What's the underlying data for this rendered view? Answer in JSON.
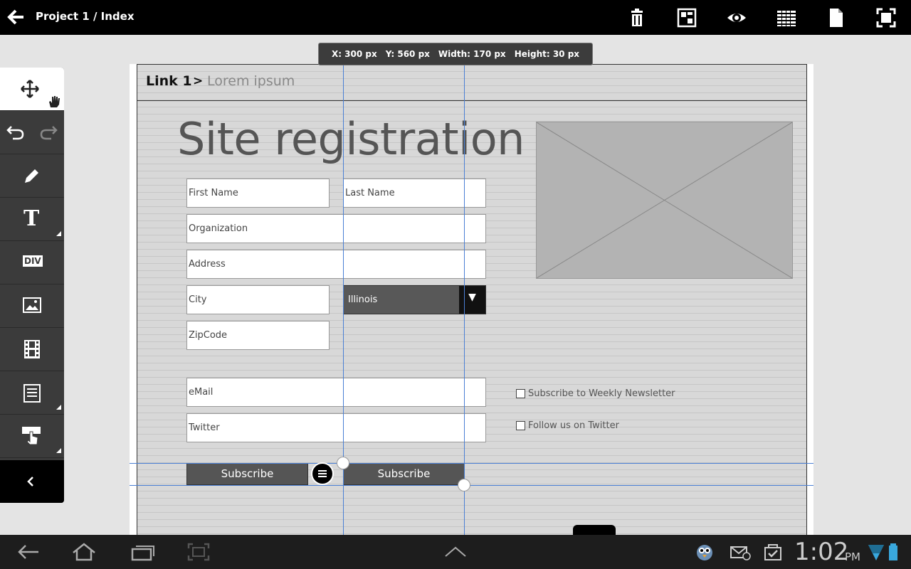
{
  "header": {
    "title": "Project 1 / Index",
    "icons": [
      "back-arrow-icon",
      "trash-icon",
      "layout-icon",
      "preview-eye-icon",
      "grid-icon",
      "page-icon",
      "fullscreen-icon"
    ]
  },
  "toolbar": {
    "tools": [
      "move-icon",
      "undo-icon",
      "redo-icon",
      "pencil-icon",
      "text-icon",
      "div-icon",
      "image-icon",
      "video-icon",
      "form-icon",
      "interaction-icon",
      "collapse-icon"
    ],
    "text_label": "T",
    "div_label": "DIV"
  },
  "info": {
    "x": "X: 300 px",
    "y": "Y: 560 px",
    "width": "Width: 170 px",
    "height": "Height: 30 px"
  },
  "page": {
    "breadcrumb_link": "Link 1",
    "breadcrumb_sep": ">",
    "breadcrumb_current": "Lorem ipsum",
    "heading": "Site registration",
    "fields": {
      "first_name": "First Name",
      "last_name": "Last Name",
      "organization": "Organization",
      "address": "Address",
      "city": "City",
      "state": "Illinois",
      "zipcode": "ZipCode",
      "email": "eMail",
      "twitter": "Twitter"
    },
    "select_arrow": "▼",
    "checkboxes": {
      "newsletter": "Subscribe to Weekly Newsletter",
      "twitter": "Follow us on Twitter"
    },
    "buttons": {
      "subscribe_1": "Subscribe",
      "subscribe_2": "Subscribe"
    }
  },
  "statusbar": {
    "time": "1:02",
    "ampm": "PM"
  },
  "colors": {
    "guide": "#4a7fd4",
    "toolbar": "#3b3b3b",
    "topbar": "#000000"
  }
}
